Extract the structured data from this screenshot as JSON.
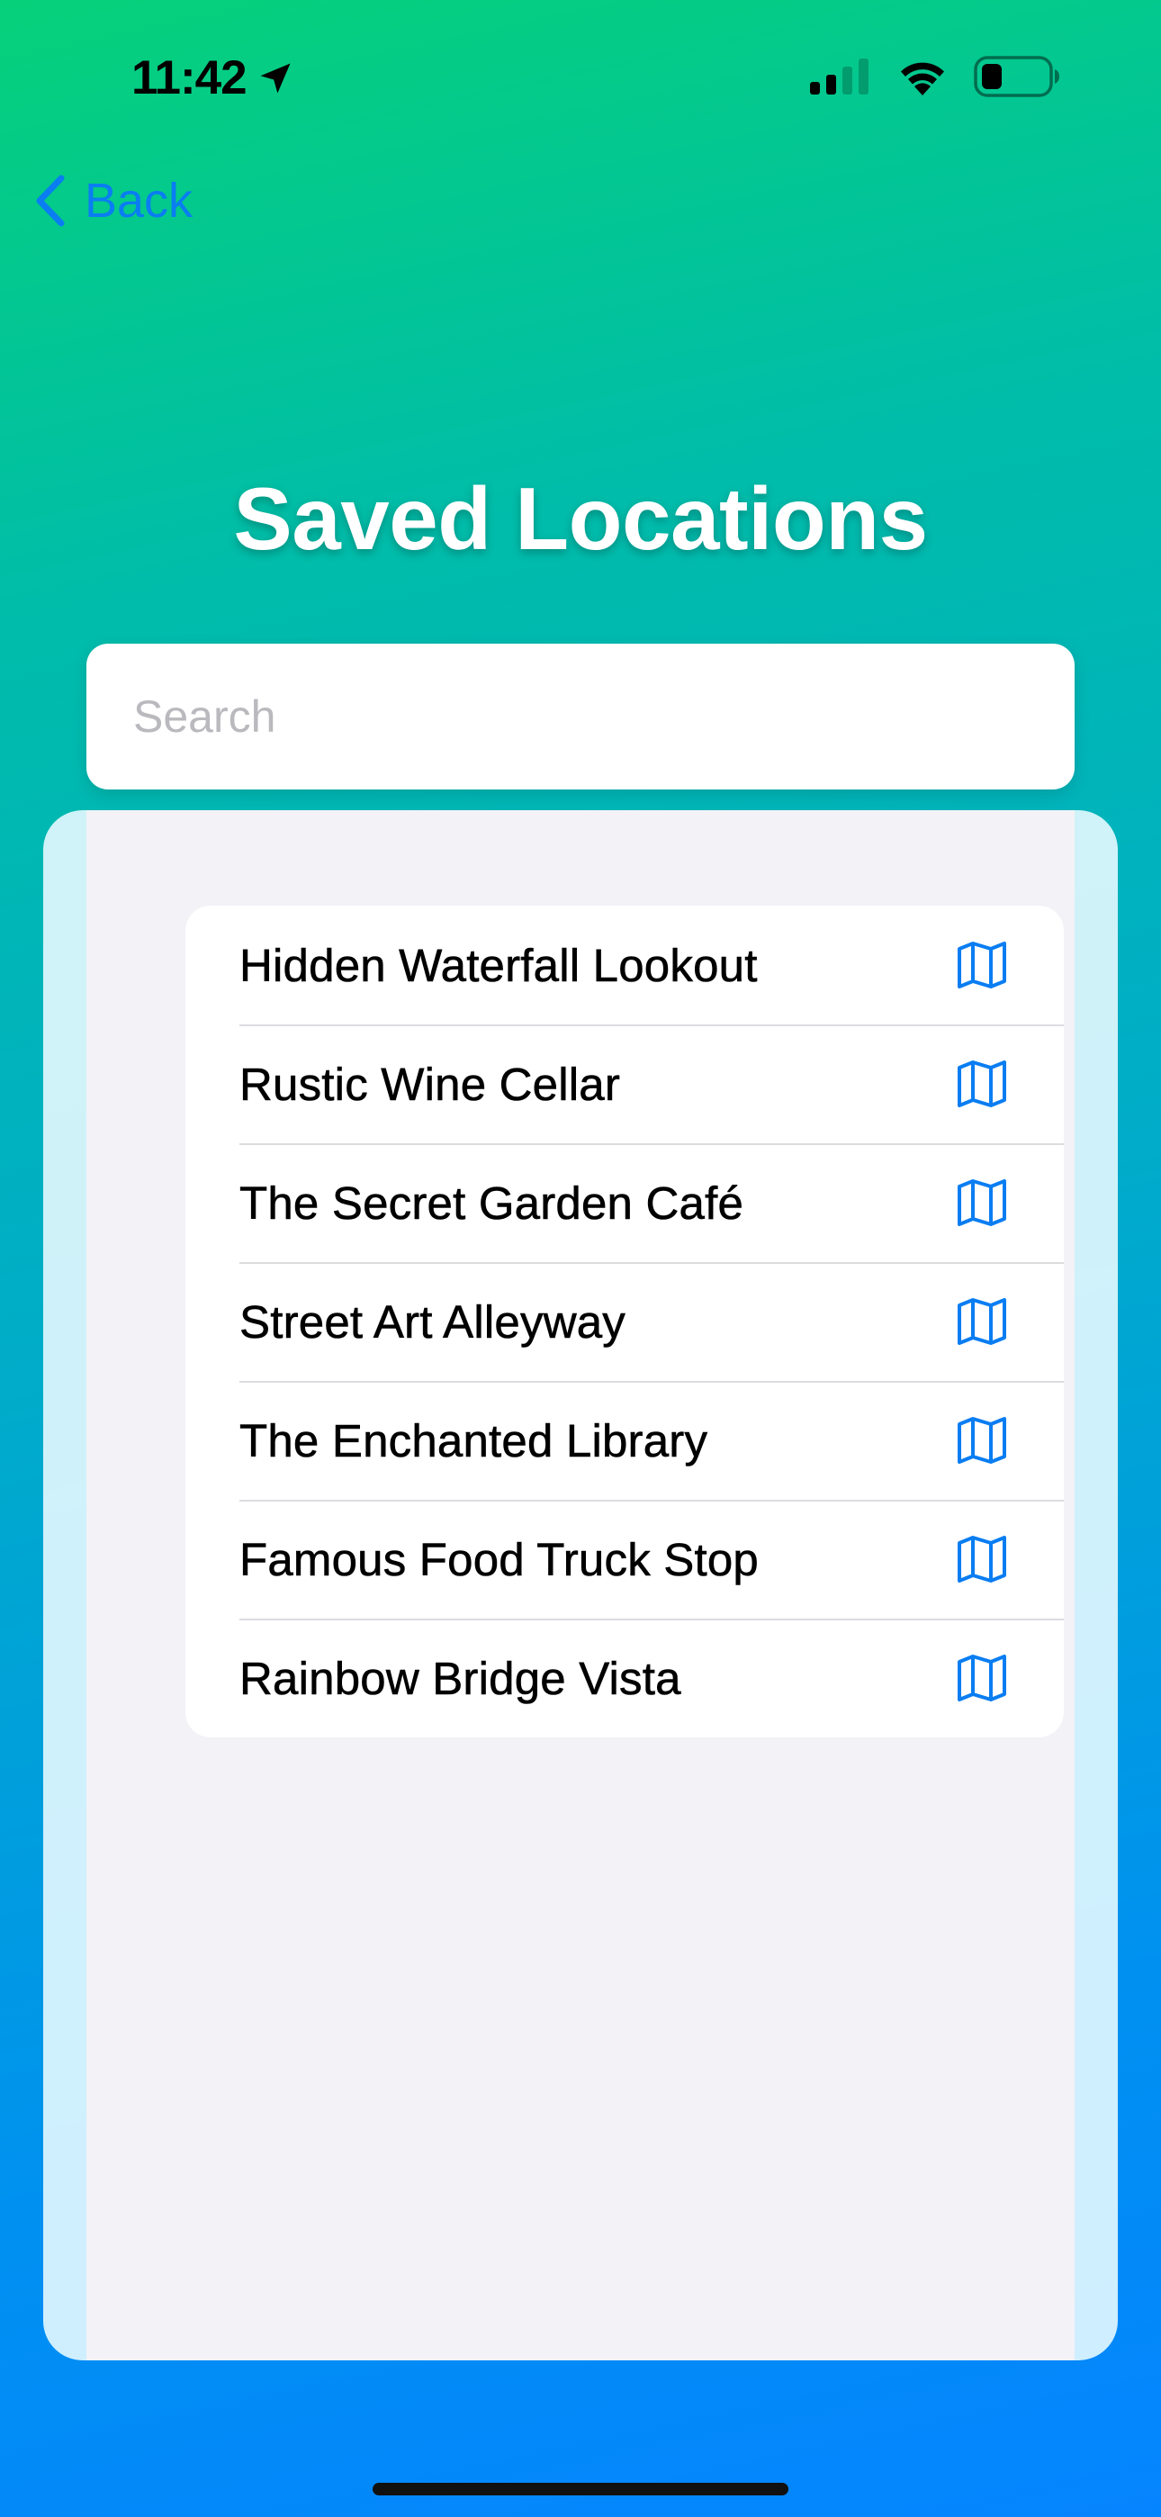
{
  "status_bar": {
    "time": "11:42",
    "icons": [
      "location-arrow-icon",
      "cellular-signal-icon",
      "wifi-icon",
      "battery-icon"
    ]
  },
  "nav": {
    "back_label": "Back"
  },
  "title": "Saved Locations",
  "search": {
    "placeholder": "Search",
    "value": ""
  },
  "locations": [
    {
      "name": "Hidden Waterfall Lookout",
      "icon": "map-icon"
    },
    {
      "name": "Rustic Wine Cellar",
      "icon": "map-icon"
    },
    {
      "name": "The Secret Garden Café",
      "icon": "map-icon"
    },
    {
      "name": "Street Art Alleyway",
      "icon": "map-icon"
    },
    {
      "name": "The Enchanted Library",
      "icon": "map-icon"
    },
    {
      "name": "Famous Food Truck Stop",
      "icon": "map-icon"
    },
    {
      "name": "Rainbow Bridge Vista",
      "icon": "map-icon"
    }
  ],
  "colors": {
    "accent": "#0a7df2",
    "gradient_top": "#06d17a",
    "gradient_bottom": "#0584ff",
    "list_background": "#f2f2f7",
    "card_background": "#ffffff"
  }
}
